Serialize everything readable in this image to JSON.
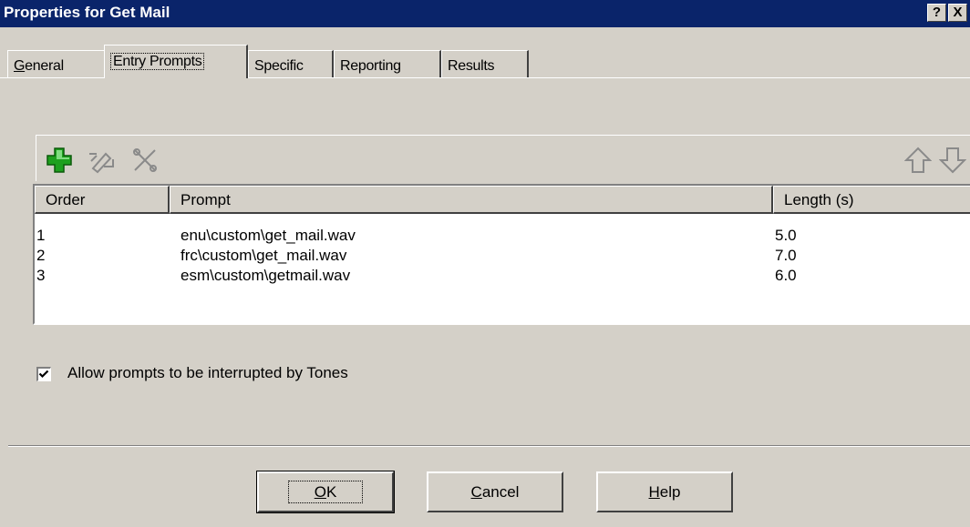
{
  "window": {
    "title": "Properties for Get Mail",
    "help_glyph": "?",
    "close_glyph": "X"
  },
  "tabs": [
    {
      "label": "General",
      "mnemonic": "G",
      "rest": "eneral"
    },
    {
      "label": "Entry Prompts"
    },
    {
      "label": "Specific"
    },
    {
      "label": "Reporting"
    },
    {
      "label": "Results"
    }
  ],
  "toolbar": {
    "icons": [
      "add-icon",
      "edit-icon",
      "delete-icon",
      "move-up-icon",
      "move-down-icon"
    ],
    "colors": {
      "add": "#1ea01e"
    }
  },
  "table": {
    "columns": [
      "Order",
      "Prompt",
      "Length (s)"
    ],
    "rows": [
      {
        "order": "1",
        "prompt": "enu\\custom\\get_mail.wav",
        "length": "5.0"
      },
      {
        "order": "2",
        "prompt": "frc\\custom\\get_mail.wav",
        "length": "7.0"
      },
      {
        "order": "3",
        "prompt": "esm\\custom\\getmail.wav",
        "length": "6.0"
      }
    ]
  },
  "options": {
    "allow_interrupt_label": "Allow prompts to be interrupted by Tones",
    "allow_interrupt_checked": true
  },
  "buttons": {
    "ok": {
      "label": "OK",
      "mnemonic": "O",
      "rest": "K"
    },
    "cancel": {
      "label": "Cancel",
      "mnemonic": "C",
      "rest": "ancel"
    },
    "help": {
      "label": "Help",
      "mnemonic": "H",
      "rest": "elp"
    }
  }
}
